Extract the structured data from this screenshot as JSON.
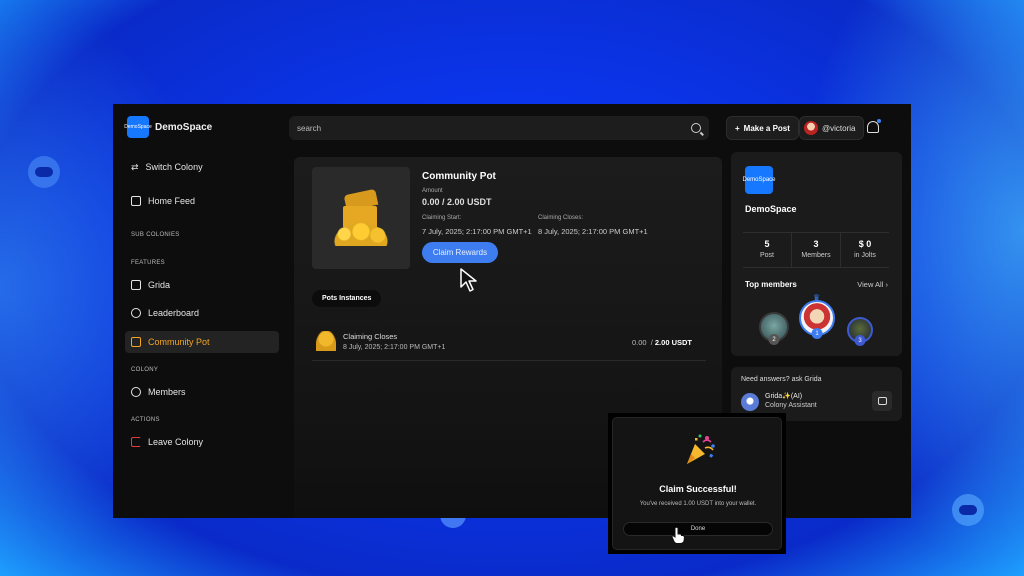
{
  "brand": {
    "name": "DemoSpace",
    "logo_text": "DemoSpace",
    "accent_color": "#1677ff"
  },
  "search": {
    "placeholder": "search"
  },
  "topbar": {
    "make_post_label": "Make a Post",
    "user_handle": "@victoria"
  },
  "sidebar": {
    "switch_colony": "Switch Colony",
    "home_feed": "Home Feed",
    "sub_colonies_label": "SUB COLONIES",
    "features_label": "FEATURES",
    "features": [
      "Grida",
      "Leaderboard",
      "Community Pot"
    ],
    "active_item": "Community Pot",
    "colony_label": "COLONY",
    "colony_items": [
      "Members"
    ],
    "actions_label": "ACTIONS",
    "actions": [
      "Leave Colony"
    ],
    "active_color": "#f5a623",
    "danger_color": "#e23b3b"
  },
  "pot": {
    "title": "Community Pot",
    "amount_label": "Amount",
    "amount_value": "0.00 / 2.00  USDT",
    "claim_start_label": "Claiming Start:",
    "claim_start_value": "7 July, 2025; 2:17:00 PM GMT+1",
    "claim_close_label": "Claiming Closes:",
    "claim_close_value": "8 July, 2025; 2:17:00 PM GMT+1",
    "claim_button": "Claim Rewards",
    "button_color": "#3d7df0"
  },
  "instances": {
    "tab_label": "Pots Instances",
    "rows": [
      {
        "title": "Claiming Closes",
        "date": "8 July, 2025; 2:17:00 PM GMT+1",
        "amount_current": "0.00",
        "amount_total": "2.00 USDT"
      }
    ]
  },
  "colony_card": {
    "name": "DemoSpace",
    "logo_text": "DemoSpace",
    "stats": [
      {
        "value": "5",
        "label": "Post"
      },
      {
        "value": "3",
        "label": "Members"
      },
      {
        "value": "$ 0",
        "label": "in Jolts"
      }
    ],
    "top_members_label": "Top members",
    "view_all": "View All",
    "member_ranks": [
      "2",
      "1",
      "3"
    ]
  },
  "assistant": {
    "question": "Need answers? ask Grida",
    "name": "Grida✨(AI)",
    "role": "Colony Assistant"
  },
  "modal": {
    "title": "Claim Successful!",
    "message": "You've received 1.00 USDT into your wallet.",
    "done_button": "Done"
  }
}
